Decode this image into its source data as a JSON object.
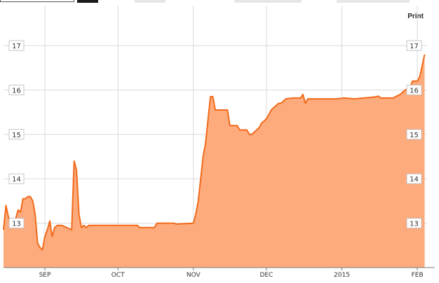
{
  "toolbar": {
    "print_label": "Print"
  },
  "colors": {
    "line": "#f26a1b",
    "fill": "#fdab7c",
    "grid": "#d9d9d9",
    "axis": "#7a7a7a",
    "text": "#333333",
    "toolbar_dark": "#1a1a1a",
    "toolbar_light": "#e6e6e6"
  },
  "chart_data": {
    "type": "area",
    "title": "",
    "xlabel": "",
    "ylabel": "",
    "ylim": [
      12.0,
      17.9
    ],
    "yticks": [
      13,
      14,
      15,
      16,
      17
    ],
    "ytick_labels": [
      "13",
      "14",
      "15",
      "16",
      "17"
    ],
    "xlim": [
      "2014-08-15",
      "2015-02-05"
    ],
    "xticks": [
      {
        "date": "2014-09-01",
        "label": "SEP"
      },
      {
        "date": "2014-10-01",
        "label": "OCT"
      },
      {
        "date": "2014-11-01",
        "label": "NOV"
      },
      {
        "date": "2014-12-01",
        "label": "DEC"
      },
      {
        "date": "2015-01-01",
        "label": "2015"
      },
      {
        "date": "2015-02-01",
        "label": "FEB"
      }
    ],
    "grid": true,
    "series": [
      {
        "name": "",
        "points": [
          [
            "2014-08-15",
            12.85
          ],
          [
            "2014-08-16",
            13.4
          ],
          [
            "2014-08-17",
            13.15
          ],
          [
            "2014-08-18",
            12.95
          ],
          [
            "2014-08-19",
            13.05
          ],
          [
            "2014-08-20",
            13.1
          ],
          [
            "2014-08-21",
            13.3
          ],
          [
            "2014-08-22",
            13.25
          ],
          [
            "2014-08-23",
            13.55
          ],
          [
            "2014-08-24",
            13.55
          ],
          [
            "2014-08-25",
            13.6
          ],
          [
            "2014-08-26",
            13.6
          ],
          [
            "2014-08-27",
            13.5
          ],
          [
            "2014-08-28",
            13.2
          ],
          [
            "2014-08-29",
            12.55
          ],
          [
            "2014-08-30",
            12.45
          ],
          [
            "2014-08-31",
            12.4
          ],
          [
            "2014-09-01",
            12.7
          ],
          [
            "2014-09-02",
            12.85
          ],
          [
            "2014-09-03",
            13.05
          ],
          [
            "2014-09-04",
            12.7
          ],
          [
            "2014-09-05",
            12.9
          ],
          [
            "2014-09-06",
            12.95
          ],
          [
            "2014-09-08",
            12.95
          ],
          [
            "2014-09-10",
            12.9
          ],
          [
            "2014-09-12",
            12.85
          ],
          [
            "2014-09-13",
            14.4
          ],
          [
            "2014-09-14",
            14.2
          ],
          [
            "2014-09-15",
            13.2
          ],
          [
            "2014-09-16",
            12.9
          ],
          [
            "2014-09-17",
            12.95
          ],
          [
            "2014-09-18",
            12.9
          ],
          [
            "2014-09-19",
            12.95
          ],
          [
            "2014-09-25",
            12.95
          ],
          [
            "2014-10-01",
            12.95
          ],
          [
            "2014-10-09",
            12.95
          ],
          [
            "2014-10-10",
            12.9
          ],
          [
            "2014-10-16",
            12.9
          ],
          [
            "2014-10-17",
            13.0
          ],
          [
            "2014-10-24",
            13.0
          ],
          [
            "2014-10-25",
            12.98
          ],
          [
            "2014-11-01",
            13.0
          ],
          [
            "2014-11-02",
            13.2
          ],
          [
            "2014-11-03",
            13.5
          ],
          [
            "2014-11-04",
            14.0
          ],
          [
            "2014-11-05",
            14.5
          ],
          [
            "2014-11-06",
            14.8
          ],
          [
            "2014-11-08",
            15.85
          ],
          [
            "2014-11-09",
            15.85
          ],
          [
            "2014-11-10",
            15.55
          ],
          [
            "2014-11-11",
            15.55
          ],
          [
            "2014-11-15",
            15.55
          ],
          [
            "2014-11-16",
            15.2
          ],
          [
            "2014-11-19",
            15.2
          ],
          [
            "2014-11-20",
            15.1
          ],
          [
            "2014-11-23",
            15.1
          ],
          [
            "2014-11-24",
            15.0
          ],
          [
            "2014-11-25",
            15.0
          ],
          [
            "2014-11-26",
            15.05
          ],
          [
            "2014-11-27",
            15.1
          ],
          [
            "2014-11-28",
            15.15
          ],
          [
            "2014-11-29",
            15.25
          ],
          [
            "2014-12-01",
            15.35
          ],
          [
            "2014-12-02",
            15.45
          ],
          [
            "2014-12-03",
            15.55
          ],
          [
            "2014-12-04",
            15.6
          ],
          [
            "2014-12-05",
            15.65
          ],
          [
            "2014-12-06",
            15.7
          ],
          [
            "2014-12-07",
            15.7
          ],
          [
            "2014-12-08",
            15.75
          ],
          [
            "2014-12-09",
            15.8
          ],
          [
            "2014-12-12",
            15.82
          ],
          [
            "2014-12-15",
            15.82
          ],
          [
            "2014-12-16",
            15.9
          ],
          [
            "2014-12-17",
            15.7
          ],
          [
            "2014-12-18",
            15.8
          ],
          [
            "2014-12-22",
            15.8
          ],
          [
            "2014-12-26",
            15.8
          ],
          [
            "2014-12-30",
            15.8
          ],
          [
            "2015-01-02",
            15.82
          ],
          [
            "2015-01-06",
            15.8
          ],
          [
            "2015-01-10",
            15.82
          ],
          [
            "2015-01-14",
            15.84
          ],
          [
            "2015-01-16",
            15.86
          ],
          [
            "2015-01-17",
            15.82
          ],
          [
            "2015-01-22",
            15.82
          ],
          [
            "2015-01-25",
            15.9
          ],
          [
            "2015-01-27",
            16.0
          ],
          [
            "2015-01-29",
            16.05
          ],
          [
            "2015-01-30",
            16.2
          ],
          [
            "2015-02-01",
            16.2
          ],
          [
            "2015-02-02",
            16.3
          ],
          [
            "2015-02-03",
            16.55
          ],
          [
            "2015-02-04",
            16.8
          ]
        ]
      }
    ]
  }
}
